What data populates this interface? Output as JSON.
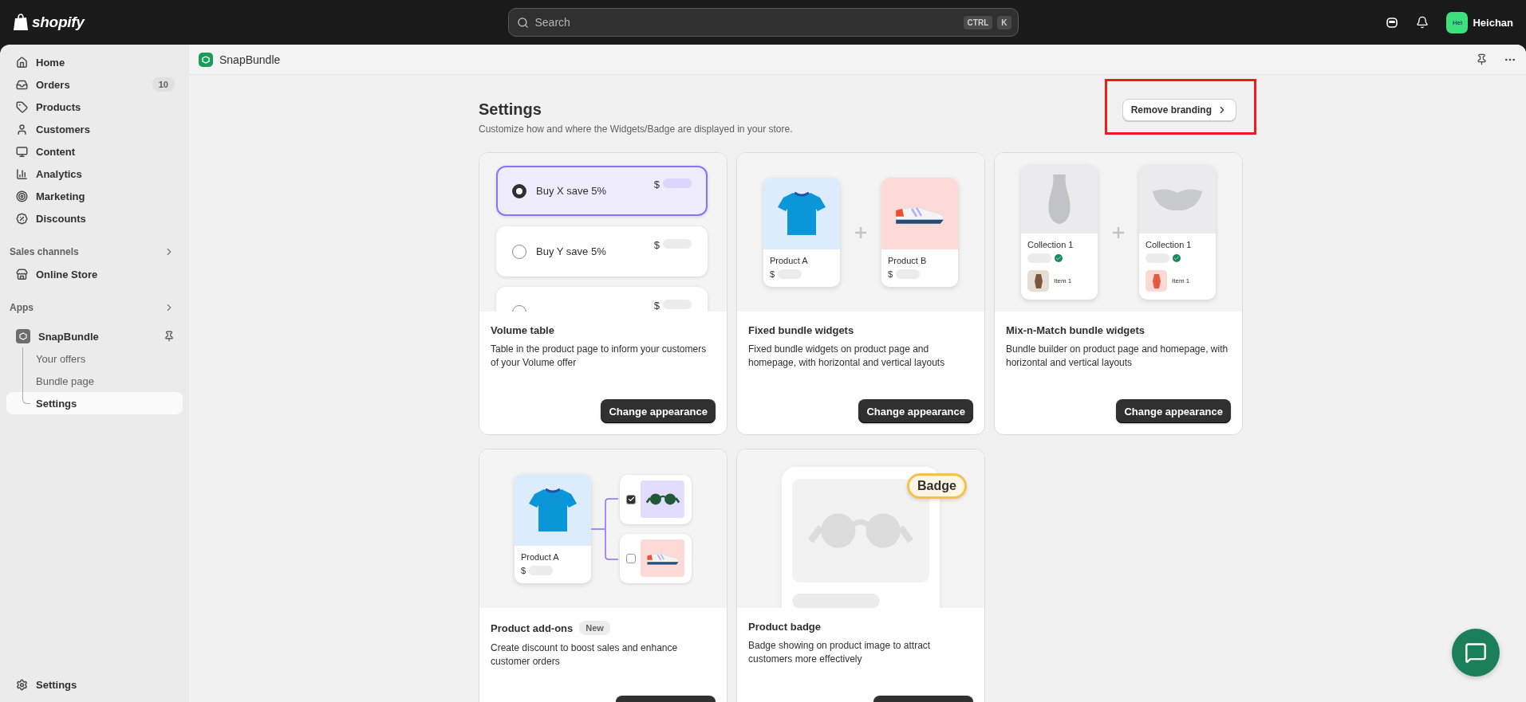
{
  "topbar": {
    "logo": "shopify",
    "search": {
      "placeholder": "Search",
      "keys": [
        "CTRL",
        "K"
      ]
    },
    "user": {
      "initials": "Hei",
      "name": "Heichan"
    }
  },
  "sidebar": {
    "items": [
      {
        "label": "Home",
        "selected": false
      },
      {
        "label": "Orders",
        "selected": false,
        "count": "10"
      },
      {
        "label": "Products",
        "selected": false
      },
      {
        "label": "Customers",
        "selected": false
      },
      {
        "label": "Content",
        "selected": false
      },
      {
        "label": "Analytics",
        "selected": false
      },
      {
        "label": "Marketing",
        "selected": false
      },
      {
        "label": "Discounts",
        "selected": false
      }
    ],
    "sections": [
      {
        "title": "Sales channels",
        "items": [
          {
            "label": "Online Store",
            "selected": false
          }
        ]
      },
      {
        "title": "Apps",
        "items": [
          {
            "label": "SnapBundle",
            "selected": false,
            "pinned": true,
            "children": [
              {
                "label": "Your offers",
                "selected": false
              },
              {
                "label": "Bundle page",
                "selected": false
              },
              {
                "label": "Settings",
                "selected": true
              }
            ]
          }
        ]
      }
    ],
    "footer": {
      "label": "Settings"
    }
  },
  "app_header": {
    "title": "SnapBundle"
  },
  "page": {
    "title": "Settings",
    "subtitle": "Customize how and where the Widgets/Badge are displayed in your store.",
    "action": "Remove branding",
    "action_highlighted": true
  },
  "cards": [
    {
      "kind": "volume",
      "title": "Volume table",
      "description": "Table in the product page to inform your customers of your Volume offer",
      "action": {
        "label": "Change appearance"
      },
      "preview": {
        "options": [
          {
            "label": "Buy X save 5%",
            "selected": true,
            "price": "$"
          },
          {
            "label": "Buy Y save 5%",
            "selected": false,
            "price": "$"
          },
          {
            "selected": false,
            "price": "$"
          }
        ]
      }
    },
    {
      "kind": "fixed",
      "title": "Fixed bundle widgets",
      "description": "Fixed bundle widgets on product page and homepage, with horizontal and vertical layouts",
      "action": {
        "label": "Change appearance"
      },
      "preview": {
        "products": [
          {
            "name": "Product A",
            "price": "$"
          },
          {
            "name": "Product B",
            "price": "$"
          }
        ]
      }
    },
    {
      "kind": "mix",
      "title": "Mix-n-Match bundle widgets",
      "description": "Bundle builder on product page and homepage, with horizontal and vertical layouts",
      "action": {
        "label": "Change appearance"
      },
      "preview": {
        "collections": [
          {
            "name": "Collection 1",
            "item": "Item 1"
          },
          {
            "name": "Collection 1",
            "item": "Item 1"
          }
        ]
      }
    },
    {
      "kind": "addons",
      "title": "Product add-ons",
      "tag": "New",
      "description": "Create discount to boost sales and enhance customer orders",
      "action": {
        "cut": true
      },
      "preview": {
        "product": {
          "name": "Product A",
          "price": "$"
        },
        "addons": [
          {
            "checked": true
          },
          {
            "checked": false
          }
        ]
      }
    },
    {
      "kind": "badge",
      "title": "Product badge",
      "description": "Badge showing on product image to attract customers more effectively",
      "action": {
        "cut": true
      },
      "preview": {
        "badge": "Badge"
      }
    }
  ]
}
